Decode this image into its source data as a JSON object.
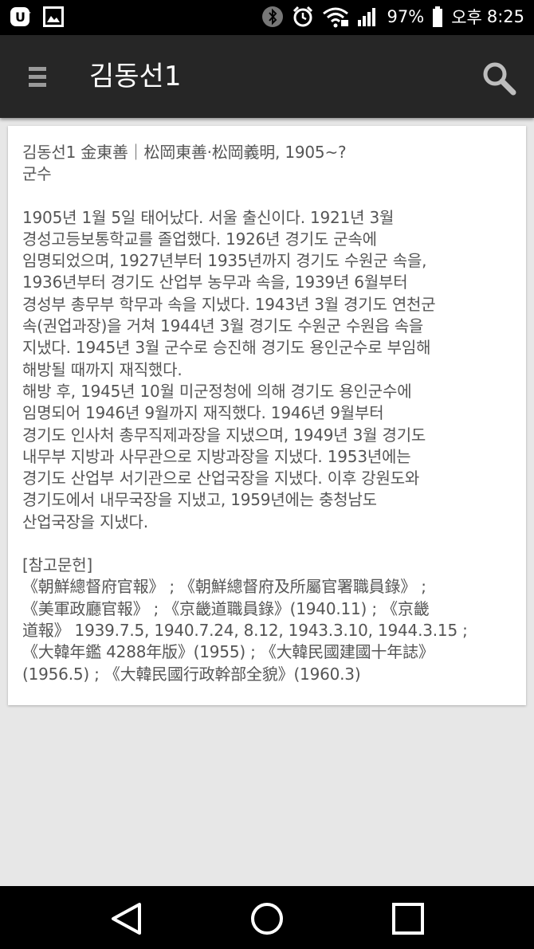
{
  "status_bar": {
    "battery": "97%",
    "ampm": "오후",
    "time": "8:25",
    "icons": [
      "lg-uplus-icon",
      "image-icon",
      "bluetooth-icon",
      "alarm-icon",
      "wifi-icon",
      "signal-icon",
      "battery-icon"
    ]
  },
  "app_bar": {
    "title": "김동선1"
  },
  "entry": {
    "heading": "김동선1 金東善｜松岡東善·松岡義明, 1905~?\n군수",
    "body": "1905년 1월 5일 태어났다. 서울 출신이다. 1921년 3월\n경성고등보통학교를 졸업했다. 1926년 경기도 군속에\n임명되었으며, 1927년부터 1935년까지 경기도 수원군 속을,\n1936년부터 경기도 산업부 농무과 속을, 1939년 6월부터\n경성부 총무부 학무과 속을 지냈다. 1943년 3월 경기도 연천군\n속(권업과장)을 거쳐 1944년 3월 경기도 수원군 수원읍 속을\n지냈다. 1945년 3월 군수로 승진해 경기도 용인군수로 부임해\n해방될 때까지 재직했다.\n해방 후, 1945년 10월 미군정청에 의해 경기도 용인군수에\n임명되어 1946년 9월까지 재직했다. 1946년 9월부터\n경기도 인사처 총무직제과장을 지냈으며, 1949년 3월 경기도\n내무부 지방과 사무관으로 지방과장을 지냈다. 1953년에는\n경기도 산업부 서기관으로 산업국장을 지냈다. 이후 강원도와\n경기도에서 내무국장을 지냈고, 1959년에는 충청남도\n산업국장을 지냈다.",
    "references": "[참고문헌]\n《朝鮮總督府官報》 ; 《朝鮮總督府及所屬官署職員錄》 ;\n《美軍政廳官報》 ; 《京畿道職員錄》(1940.11) ; 《京畿\n道報》 1939.7.5, 1940.7.24, 8.12, 1943.3.10, 1944.3.15 ;\n《大韓年鑑 4288年版》(1955) ; 《大韓民國建國十年誌》\n(1956.5) ; 《大韓民國行政幹部全貌》(1960.3)"
  },
  "nav_bar": {
    "icons": [
      "back-icon",
      "home-icon",
      "recents-icon"
    ]
  }
}
